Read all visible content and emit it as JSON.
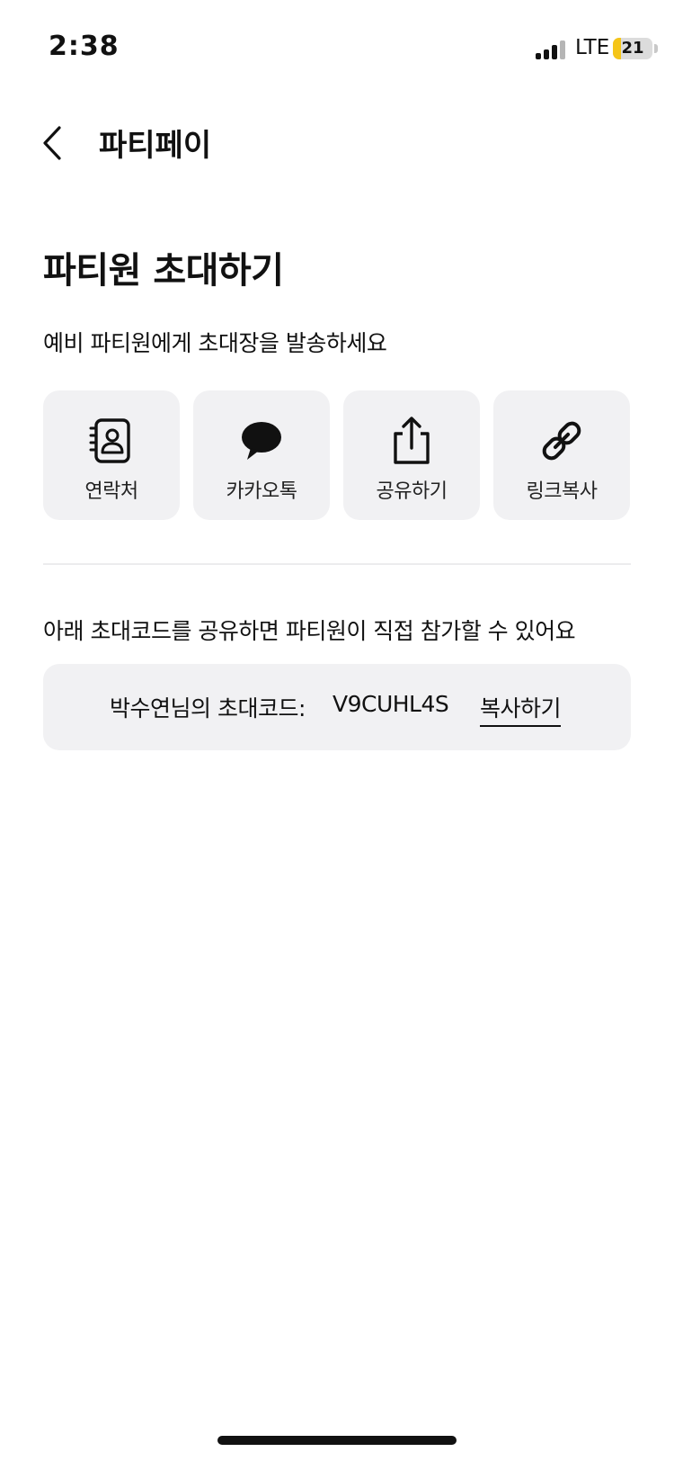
{
  "status_bar": {
    "time": "2:38",
    "network": "LTE",
    "battery": "21",
    "battery_level_percent": 21
  },
  "nav": {
    "title": "파티페이"
  },
  "page": {
    "title": "파티원 초대하기",
    "subtitle": "예비 파티원에게 초대장을 발송하세요"
  },
  "share_options": [
    {
      "label": "연락처",
      "icon": "contacts-icon"
    },
    {
      "label": "카카오톡",
      "icon": "kakaotalk-icon"
    },
    {
      "label": "공유하기",
      "icon": "share-icon"
    },
    {
      "label": "링크복사",
      "icon": "link-icon"
    }
  ],
  "invite_code": {
    "description": "아래 초대코드를 공유하면 파티원이 직접 참가할 수 있어요",
    "label": "박수연님의 초대코드:",
    "code": "V9CUHL4S",
    "copy_label": "복사하기"
  },
  "colors": {
    "tile_background": "#f1f1f3",
    "battery_fill": "#f5c518",
    "text": "#111111"
  }
}
